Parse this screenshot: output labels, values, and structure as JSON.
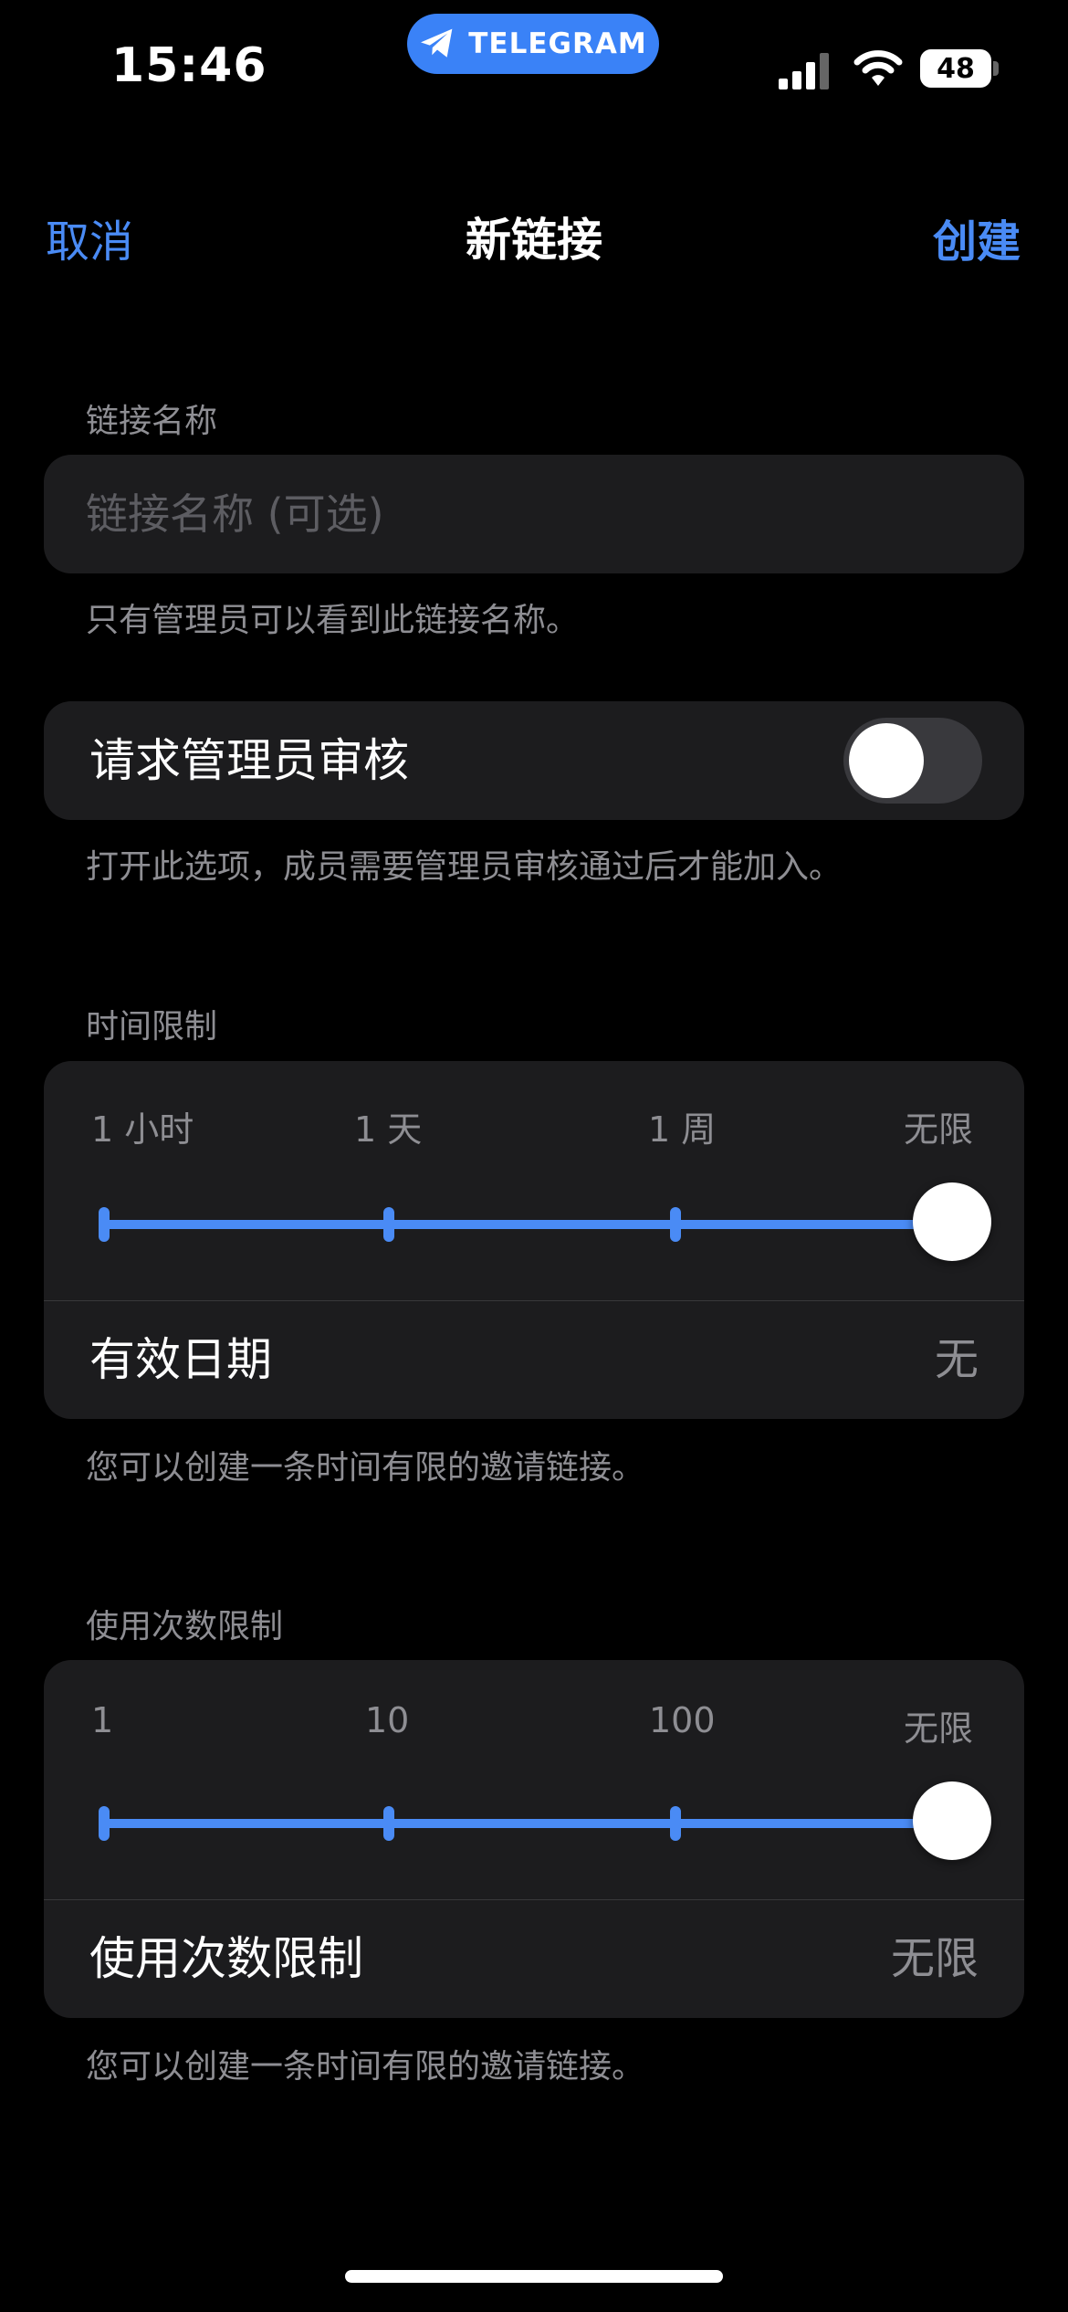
{
  "status_bar": {
    "time": "15:46",
    "pill_label": "TELEGRAM",
    "battery": "48"
  },
  "nav": {
    "cancel": "取消",
    "title": "新链接",
    "create": "创建"
  },
  "link_name": {
    "section_label": "链接名称",
    "placeholder": "链接名称 (可选)",
    "note": "只有管理员可以看到此链接名称。"
  },
  "approval": {
    "label": "请求管理员审核",
    "enabled": false,
    "note": "打开此选项，成员需要管理员审核通过后才能加入。"
  },
  "time_limit": {
    "section_label": "时间限制",
    "ticks": [
      "1 小时",
      "1 天",
      "1 周",
      "无限"
    ],
    "selected_index": 3,
    "row_label": "有效日期",
    "row_value": "无",
    "note": "您可以创建一条时间有限的邀请链接。"
  },
  "usage_limit": {
    "section_label": "使用次数限制",
    "ticks": [
      "1",
      "10",
      "100",
      "无限"
    ],
    "selected_index": 3,
    "row_label": "使用次数限制",
    "row_value": "无限",
    "note": "您可以创建一条时间有限的邀请链接。"
  },
  "colors": {
    "accent": "#4a8bf5",
    "background": "#000000",
    "card": "#1c1c1e",
    "secondary_text": "#8e8e93"
  }
}
